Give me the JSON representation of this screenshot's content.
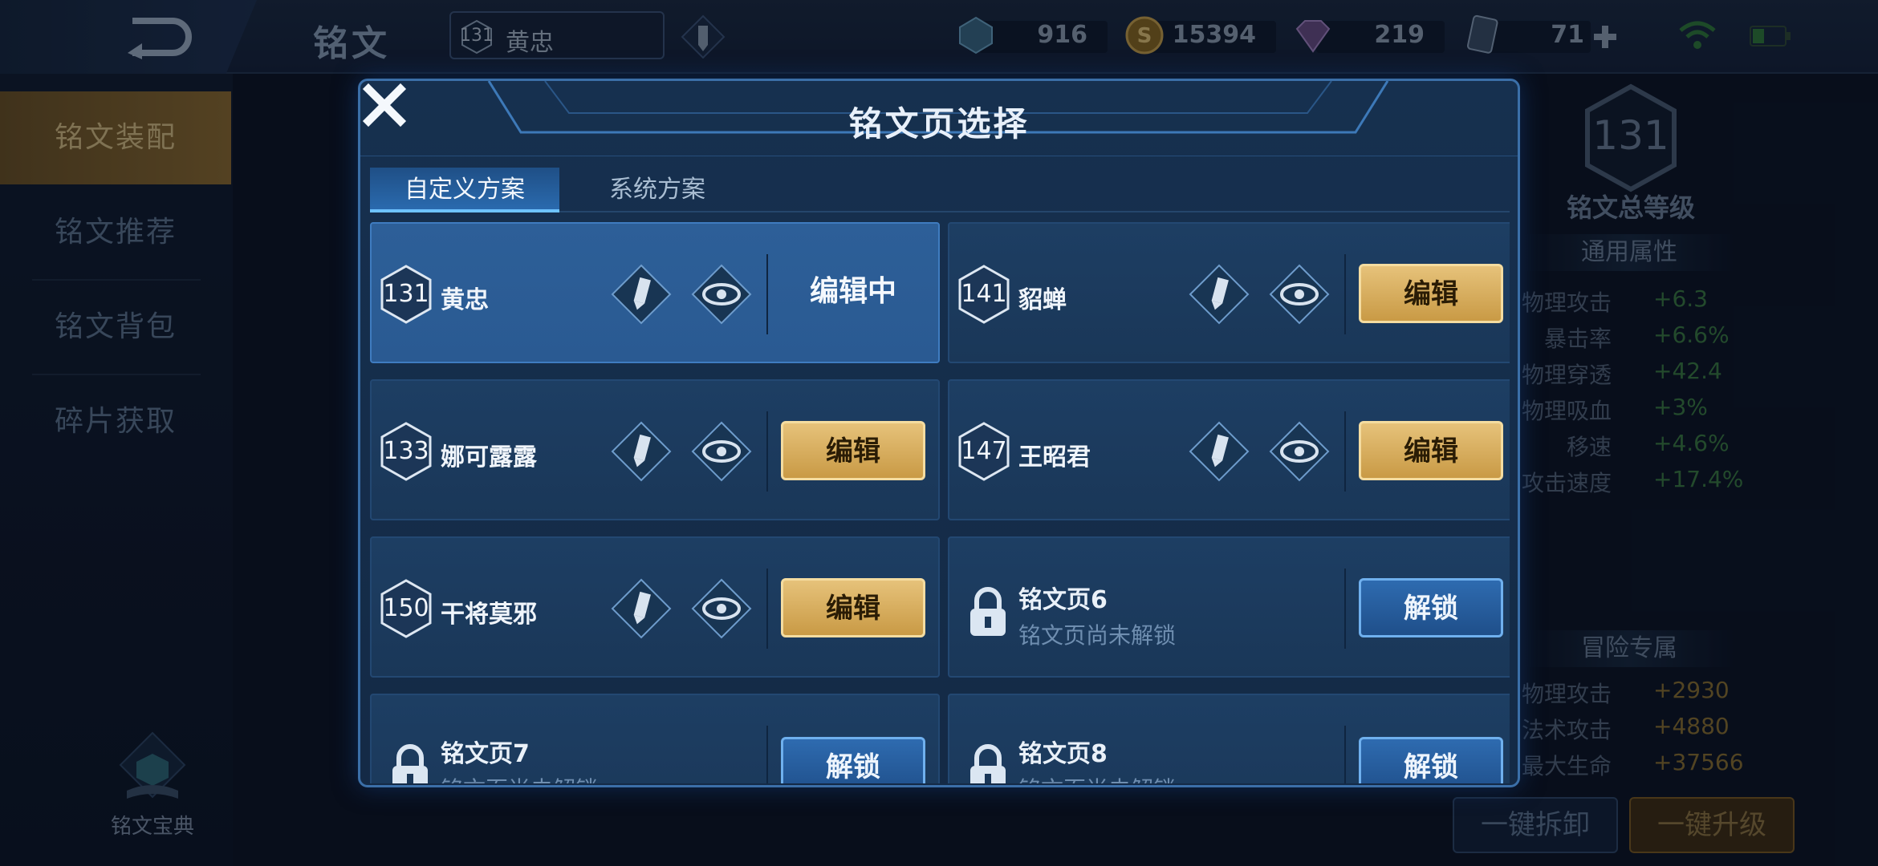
{
  "topbar": {
    "title": "铭文",
    "hero_level": "131",
    "hero_name": "黄忠",
    "currencies": [
      {
        "icon": "diamond-icon",
        "value": "916"
      },
      {
        "icon": "gold-coin-icon",
        "value": "15394"
      },
      {
        "icon": "gem-icon",
        "value": "219"
      },
      {
        "icon": "card-ticket-icon",
        "value": "71"
      }
    ]
  },
  "sidebar": {
    "items": [
      {
        "label": "铭文装配"
      },
      {
        "label": "铭文推荐"
      },
      {
        "label": "铭文背包"
      },
      {
        "label": "碎片获取"
      }
    ],
    "codex_label": "铭文宝典"
  },
  "right": {
    "total_level": "131",
    "total_level_label": "铭文总等级",
    "general_header": "通用属性",
    "general_attrs": [
      {
        "k": "物理攻击",
        "v": "+6.3"
      },
      {
        "k": "暴击率",
        "v": "+6.6%"
      },
      {
        "k": "物理穿透",
        "v": "+42.4"
      },
      {
        "k": "物理吸血",
        "v": "+3%"
      },
      {
        "k": "移速",
        "v": "+4.6%"
      },
      {
        "k": "攻击速度",
        "v": "+17.4%"
      }
    ],
    "adventure_header": "冒险专属",
    "adventure_attrs": [
      {
        "k": "物理攻击",
        "v": "+2930"
      },
      {
        "k": "法术攻击",
        "v": "+4880"
      },
      {
        "k": "最大生命",
        "v": "+37566"
      }
    ],
    "btn_dismount": "一键拆卸",
    "btn_upgrade": "一键升级"
  },
  "modal": {
    "title": "铭文页选择",
    "tabs": [
      "自定义方案",
      "系统方案"
    ],
    "pages": [
      {
        "level": "131",
        "name": "黄忠",
        "action": "编辑中",
        "state": "editing"
      },
      {
        "level": "141",
        "name": "貂蝉",
        "action": "编辑",
        "state": "edit"
      },
      {
        "level": "133",
        "name": "娜可露露",
        "action": "编辑",
        "state": "edit"
      },
      {
        "level": "147",
        "name": "王昭君",
        "action": "编辑",
        "state": "edit"
      },
      {
        "level": "150",
        "name": "干将莫邪",
        "action": "编辑",
        "state": "edit"
      }
    ],
    "locked": [
      {
        "title": "铭文页6",
        "sub": "铭文页尚未解锁",
        "action": "解锁"
      },
      {
        "title": "铭文页7",
        "sub": "铭文页尚未解锁",
        "action": "解锁"
      },
      {
        "title": "铭文页8",
        "sub": "铭文页尚未解锁",
        "action": "解锁"
      }
    ]
  }
}
